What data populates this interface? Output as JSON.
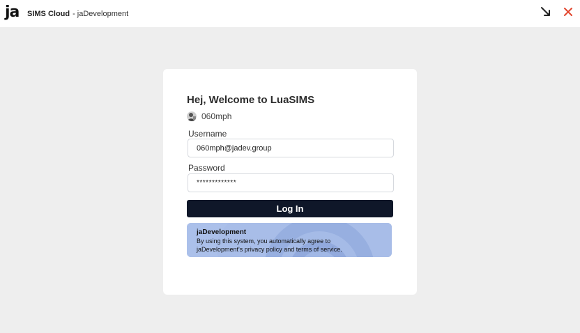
{
  "window": {
    "logo_text": "ja",
    "app_name": "SIMS Cloud",
    "separator": "-",
    "org_name": "jaDevelopment",
    "controls": [
      "minimize-arrow-icon",
      "close-icon"
    ],
    "close_color": "#e2452d"
  },
  "login": {
    "welcome": "Hej, Welcome to LuaSIMS",
    "user": {
      "avatar_icon": "user-avatar-icon",
      "name": "060mph"
    },
    "username": {
      "label": "Username",
      "value": "060mph@jadev.group"
    },
    "password": {
      "label": "Password",
      "value": "*************"
    },
    "submit_label": "Log In",
    "notice": {
      "title": "jaDevelopment",
      "line1": "By using this system, you automatically agree to",
      "line2": "jaDevelopment's privacy policy and terms of service."
    }
  },
  "colors": {
    "background": "#eeeeee",
    "button": "#0f1729",
    "notice": "#a8bde8"
  }
}
